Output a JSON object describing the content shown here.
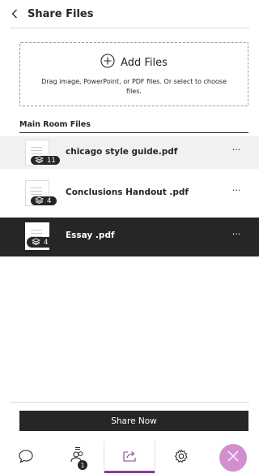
{
  "header": {
    "title": "Share Files",
    "back_icon": "chevron-left-icon"
  },
  "dropzone": {
    "add_label": "Add Files",
    "hint": "Drag image, PowerPoint, or PDF files. Or select to choose files."
  },
  "section": {
    "title": "Main Room Files"
  },
  "files": [
    {
      "name": "chicago style guide.pdf",
      "pages": "11",
      "more": "···"
    },
    {
      "name": "Conclusions Handout .pdf",
      "pages": "4",
      "more": "···"
    },
    {
      "name": "Essay .pdf",
      "pages": "4",
      "more": "···"
    }
  ],
  "share_button": {
    "label": "Share Now"
  },
  "tabs": [
    {
      "icon": "chat-bubble-icon"
    },
    {
      "icon": "attendees-icon",
      "badge": "1"
    },
    {
      "icon": "share-content-icon",
      "active": true
    },
    {
      "icon": "settings-gear-icon"
    },
    {
      "icon": "close-icon"
    }
  ],
  "colors": {
    "accent": "#8a3b9e",
    "dark": "#262626",
    "close_bg": "#d18fcf"
  }
}
